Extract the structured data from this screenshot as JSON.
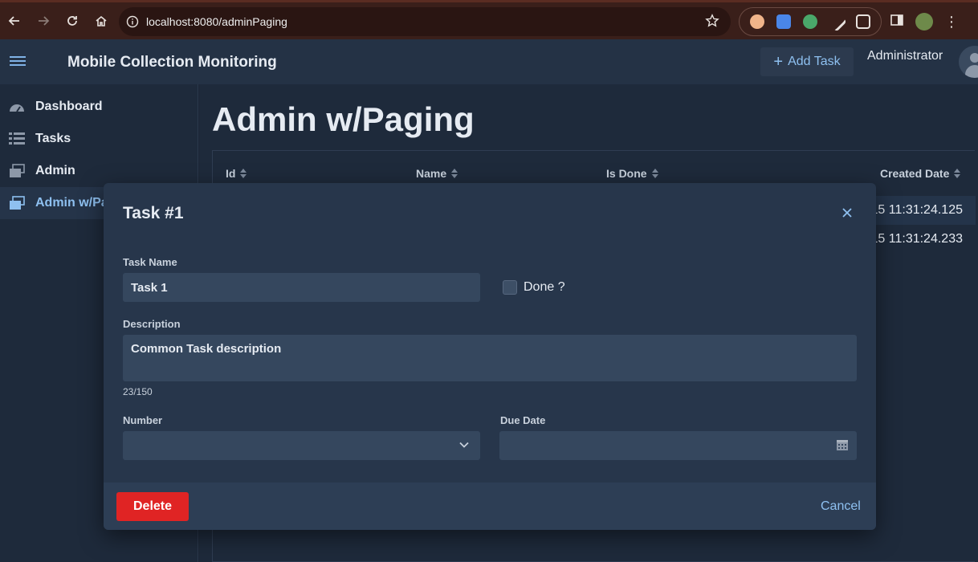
{
  "browser": {
    "url": "localhost:8080/adminPaging"
  },
  "header": {
    "app_title": "Mobile Collection Monitoring",
    "add_task_label": "Add Task",
    "user_name": "Administrator"
  },
  "sidebar": {
    "items": [
      {
        "label": "Dashboard",
        "icon": "dashboard-icon"
      },
      {
        "label": "Tasks",
        "icon": "list-icon"
      },
      {
        "label": "Admin",
        "icon": "admin-icon"
      },
      {
        "label": "Admin w/Pa",
        "icon": "admin-icon",
        "active": true
      }
    ]
  },
  "main": {
    "title": "Admin w/Paging",
    "table": {
      "columns": [
        "Id",
        "Name",
        "Is Done",
        "Created Date"
      ],
      "rows": [
        {
          "created_date": "15 11:31:24.125"
        },
        {
          "created_date": "15 11:31:24.233"
        }
      ]
    }
  },
  "dialog": {
    "title": "Task #1",
    "task_name_label": "Task Name",
    "task_name_value": "Task 1",
    "done_label": "Done ?",
    "done_checked": false,
    "description_label": "Description",
    "description_value": "Common Task description",
    "char_counter": "23/150",
    "number_label": "Number",
    "number_value": "",
    "due_date_label": "Due Date",
    "due_date_value": "",
    "delete_label": "Delete",
    "cancel_label": "Cancel"
  },
  "colors": {
    "accent": "#8ec0f0",
    "danger": "#e02424",
    "background": "#1e2a3b"
  }
}
